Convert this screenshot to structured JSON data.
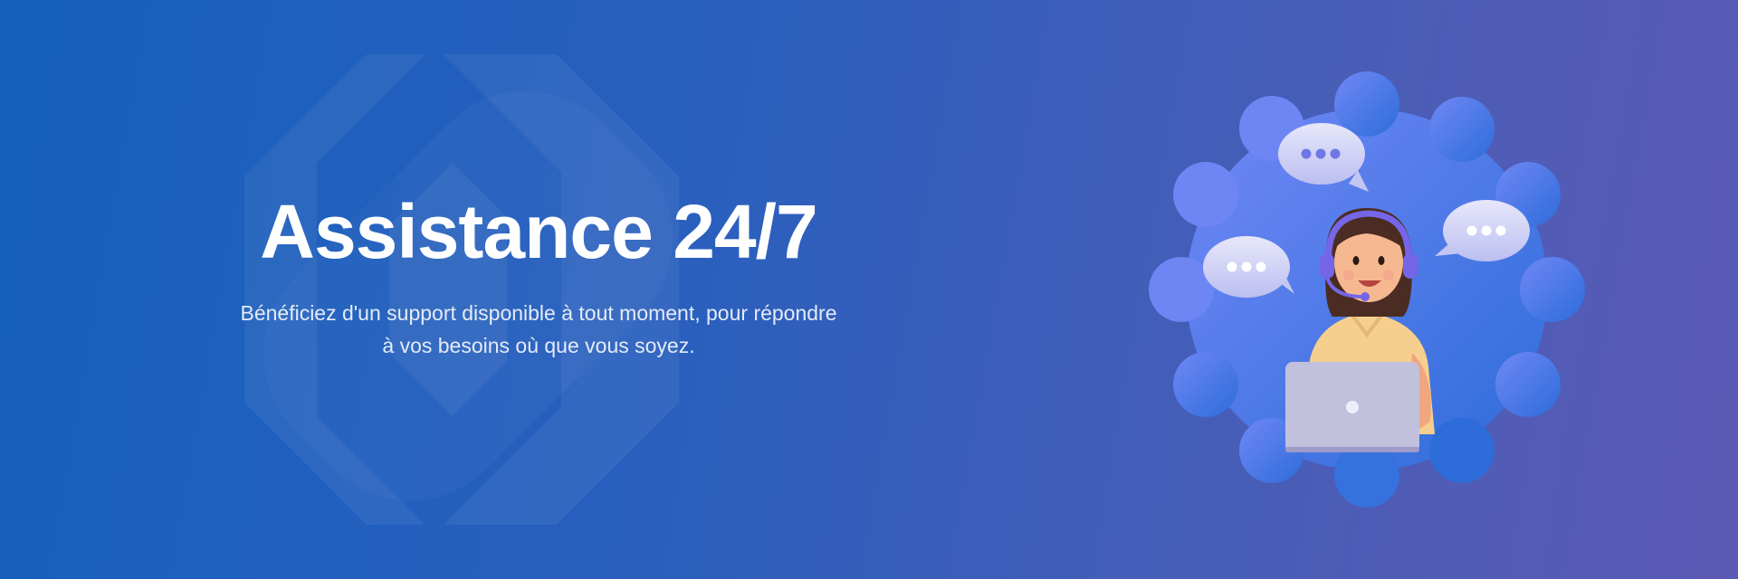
{
  "hero": {
    "title": "Assistance 24/7",
    "subtitle_line1": "Bénéficiez d'un support disponible à tout moment, pour répondre",
    "subtitle_line2": "à vos besoins où que vous soyez."
  },
  "colors": {
    "background_start": "#1560bd",
    "background_end": "#5b5ab5",
    "blob_start": "#6f86f5",
    "blob_end": "#2f6fdc",
    "shirt": "#f6cf8f",
    "laptop": "#b7b5d8",
    "headset": "#7566e8"
  },
  "icons": [
    "watermark-logo",
    "chat-bubble-icon",
    "support-agent-illustration",
    "laptop-icon",
    "headset-icon"
  ]
}
